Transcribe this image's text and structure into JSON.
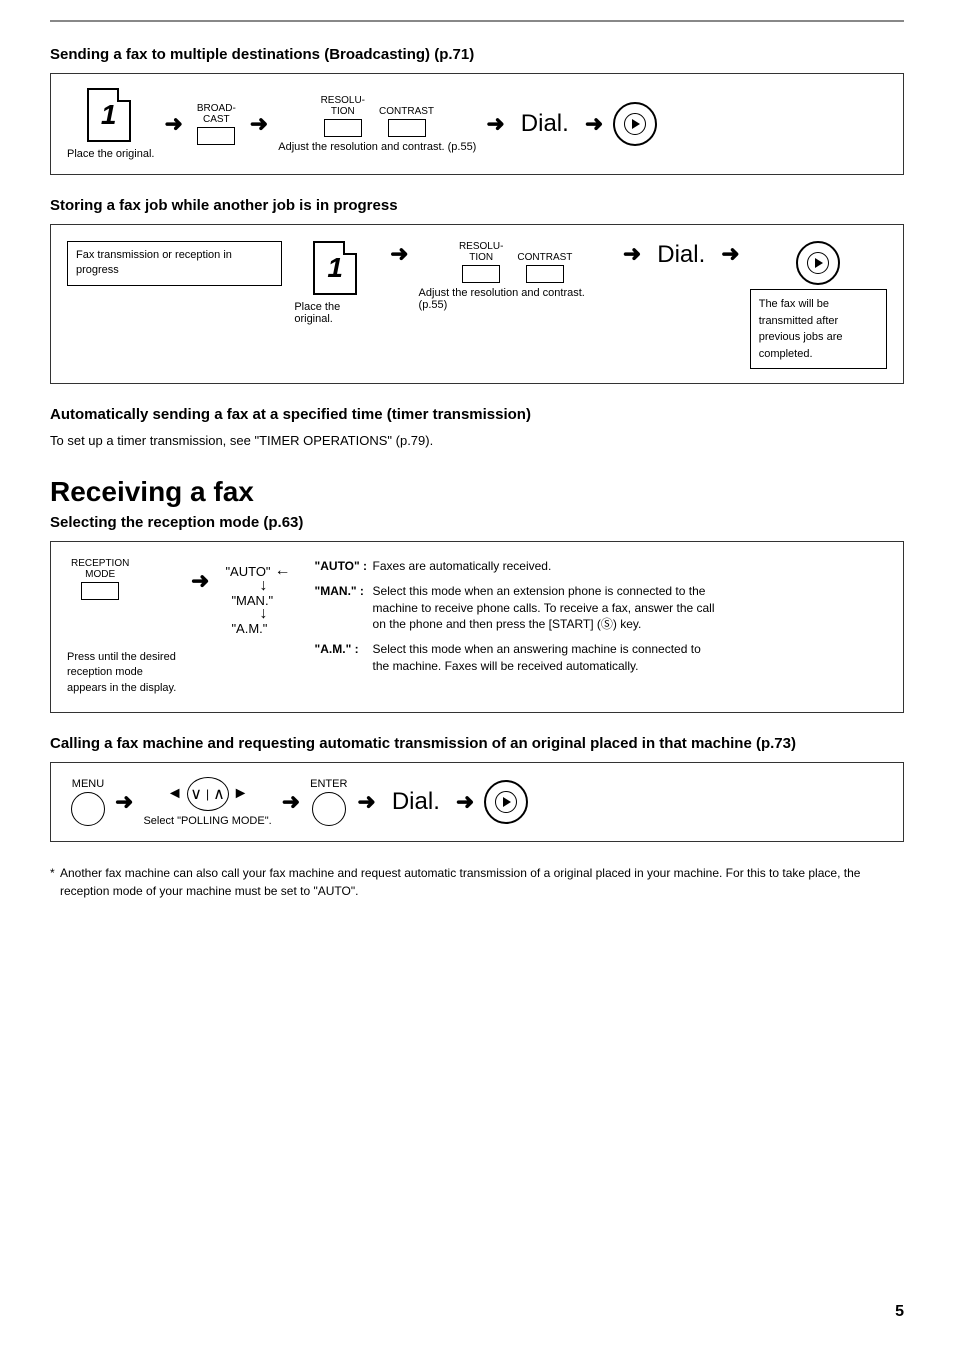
{
  "page": {
    "page_number": "5",
    "top_line": true
  },
  "section1": {
    "title": "Sending a fax to multiple destinations (Broadcasting) (p.71)",
    "steps": {
      "step1_caption": "Place the original.",
      "broadcast_label": "BROAD-\nCAST",
      "resolution_label": "RESOLU-\nTION",
      "contrast_label": "CONTRAST",
      "adjust_caption": "Adjust the resolution\nand contrast. (p.55)",
      "dial_text": "Dial."
    }
  },
  "section2": {
    "title": "Storing a fax job while another job is in progress",
    "steps": {
      "fax_status": "Fax transmission\nor reception in\nprogress",
      "place_caption": "Place the original.",
      "resolution_label": "RESOLU-\nTION",
      "contrast_label": "CONTRAST",
      "adjust_caption": "Adjust the resolution\nand contrast. (p.55)",
      "dial_text": "Dial.",
      "result_text": "The fax will be\ntransmitted after\nprevious jobs are\ncompleted."
    }
  },
  "section3": {
    "title": "Automatically sending a fax at a specified time (timer transmission)",
    "body": "To set up a timer transmission, see \"TIMER OPERATIONS\" (p.79)."
  },
  "section4": {
    "title": "Receiving a fax",
    "subtitle": "Selecting the reception mode (p.63)",
    "steps": {
      "reception_mode_label": "RECEPTION\nMODE",
      "auto_label": "\"AUTO\"",
      "man_label": "\"MAN.\"",
      "am_label": "\"A.M.\"",
      "press_caption": "Press until the desired\nreception mode appears\nin the display.",
      "auto_desc_label": "\"AUTO\" :",
      "auto_desc": "Faxes are automatically received.",
      "man_desc_label": "\"MAN.\" :",
      "man_desc": "Select this mode when an extension phone is connected to the machine to receive phone calls. To receive a fax, answer the call on the phone and then press the [START] (Ⓢ) key.",
      "am_desc_label": "\"A.M.\" :",
      "am_desc": "Select this mode when an answering machine is connected to the machine. Faxes will be received automatically."
    }
  },
  "section5": {
    "title": "Calling a fax machine and requesting automatic transmission of an original placed in that machine (p.73)",
    "steps": {
      "menu_label": "MENU",
      "enter_label": "ENTER",
      "select_caption": "Select \"POLLING MODE\".",
      "dial_text": "Dial."
    }
  },
  "footnote": "Another fax machine can also call your fax machine and request automatic transmission of a original placed in your machine. For this to take place, the reception mode of your machine must be set to \"AUTO\"."
}
